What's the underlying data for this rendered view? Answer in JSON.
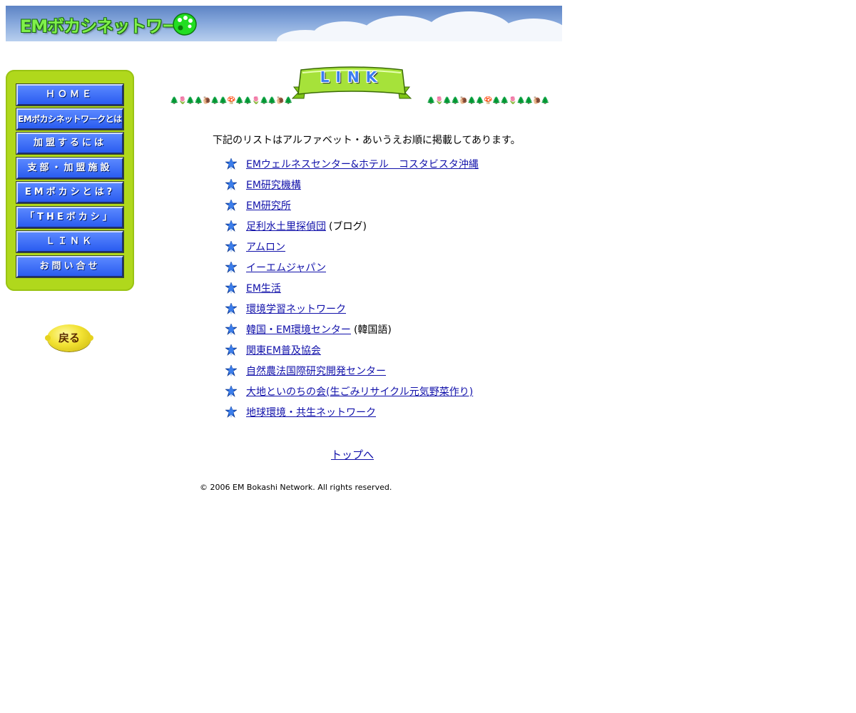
{
  "header": {
    "title": "EMボカシネットワーク",
    "icon": "palette-icon"
  },
  "sidebar": {
    "items": [
      {
        "label": "ＨＯＭＥ"
      },
      {
        "label": "EMボカシネットワークとは?"
      },
      {
        "label": "加盟するには"
      },
      {
        "label": "支部・加盟施設"
      },
      {
        "label": "EMボカシとは?"
      },
      {
        "label": "「THEボカシ」"
      },
      {
        "label": "ＬＩＮＫ"
      },
      {
        "label": "お問い合せ"
      }
    ],
    "back_label": "戻る"
  },
  "page_heading": {
    "label": "LINK",
    "decoration_left": "🌲🌷🌲🌲🐌🌲🌲🍄🌲🌲🌷🌲🌲🐌🌲",
    "decoration_right": "🌲🌷🌲🌲🐌🌲🌲🍄🌲🌲🌷🌲🌲🐌🌲"
  },
  "intro": "下記のリストはアルファベット・あいうえお順に掲載してあります。",
  "links": [
    {
      "text": "EMウェルネスセンター&ホテル　コスタビスタ沖縄",
      "note": ""
    },
    {
      "text": "EM研究機構",
      "note": ""
    },
    {
      "text": "EM研究所",
      "note": ""
    },
    {
      "text": "足利水土里探偵団",
      "note": "(ブログ)"
    },
    {
      "text": "アムロン",
      "note": ""
    },
    {
      "text": "イーエムジャパン",
      "note": ""
    },
    {
      "text": "EM生活",
      "note": ""
    },
    {
      "text": "環境学習ネットワーク",
      "note": ""
    },
    {
      "text": "韓国・EM環境センター",
      "note": "(韓国語)"
    },
    {
      "text": "関東EM普及協会",
      "note": ""
    },
    {
      "text": "自然農法国際研究開発センター",
      "note": ""
    },
    {
      "text": "大地といのちの会(生ごみリサイクル元気野菜作り)",
      "note": ""
    },
    {
      "text": "地球環境・共生ネットワーク",
      "note": ""
    }
  ],
  "top_link": "トップへ",
  "copyright": "© 2006 EM Bokashi Network. All rights reserved.",
  "colors": {
    "sidebar_bg": "#b0d81c",
    "nav_button": "#2a5cf0",
    "link": "#1111aa",
    "star": "#1a5fd6"
  }
}
